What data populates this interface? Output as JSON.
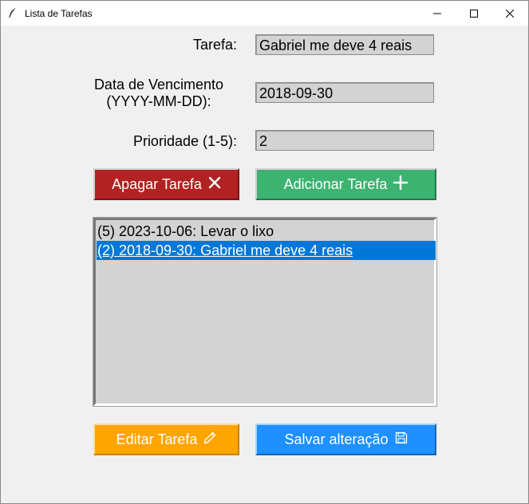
{
  "window": {
    "title": "Lista de Tarefas",
    "controls": {
      "minimize": "minimize-icon",
      "maximize": "maximize-icon",
      "close": "close-icon"
    }
  },
  "form": {
    "task_label": "Tarefa:",
    "task_value": "Gabriel me deve 4 reais",
    "due_label_line1": "Data de Vencimento",
    "due_label_line2": "(YYYY-MM-DD):",
    "due_value": "2018-09-30",
    "priority_label": "Prioridade (1-5):",
    "priority_value": "2"
  },
  "actions": {
    "delete_label": "Apagar Tarefa",
    "delete_icon": "x-icon",
    "add_label": "Adicionar Tarefa",
    "add_icon": "plus-icon",
    "edit_label": "Editar Tarefa",
    "edit_icon": "pencil-icon",
    "save_label": "Salvar alteração",
    "save_icon": "floppy-disk-icon"
  },
  "task_list": {
    "items": [
      {
        "text": "(5) 2023-10-06: Levar o lixo",
        "selected": false
      },
      {
        "text": "(2) 2018-09-30: Gabriel me deve 4 reais",
        "selected": true
      }
    ]
  },
  "colors": {
    "delete": "#b22222",
    "add": "#3cb371",
    "edit": "#ffa500",
    "save": "#1e90ff",
    "selection": "#0078d7"
  }
}
